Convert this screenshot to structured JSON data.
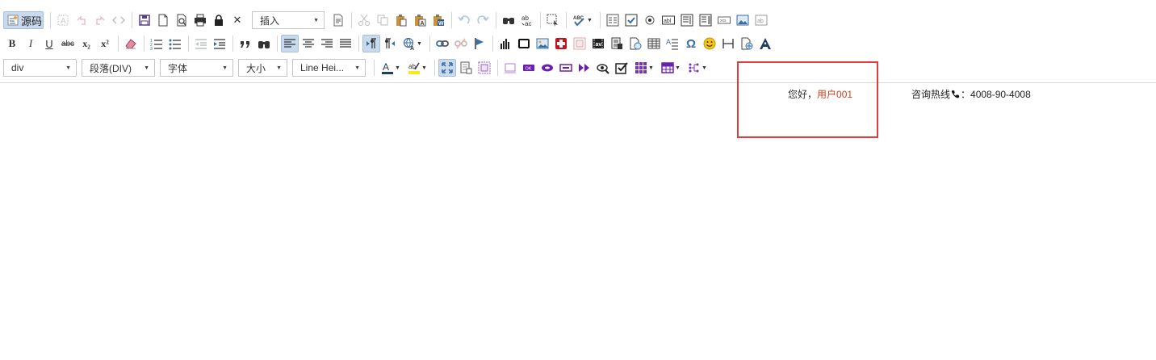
{
  "toolbar": {
    "source_label": "源码",
    "insert_combo": "插入",
    "format_combo": "div",
    "paragraph_combo": "段落(DIV)",
    "font_combo": "字体",
    "size_combo": "大小",
    "lineheight_combo": "Line Hei...",
    "bold": "B",
    "italic": "I",
    "underline": "U",
    "strike": "abc",
    "subscript": "x₂",
    "superscript": "x²",
    "omega": "Ω",
    "close": "✕"
  },
  "header": {
    "greeting_prefix": "您好，",
    "username": "用户001",
    "hotline_label": "咨询热线",
    "hotline_number": "：4008-90-4008"
  },
  "colors": {
    "accent_active": "#c9d9ee",
    "username_color": "#c8401f",
    "highlight_box": "#e03c3c"
  }
}
